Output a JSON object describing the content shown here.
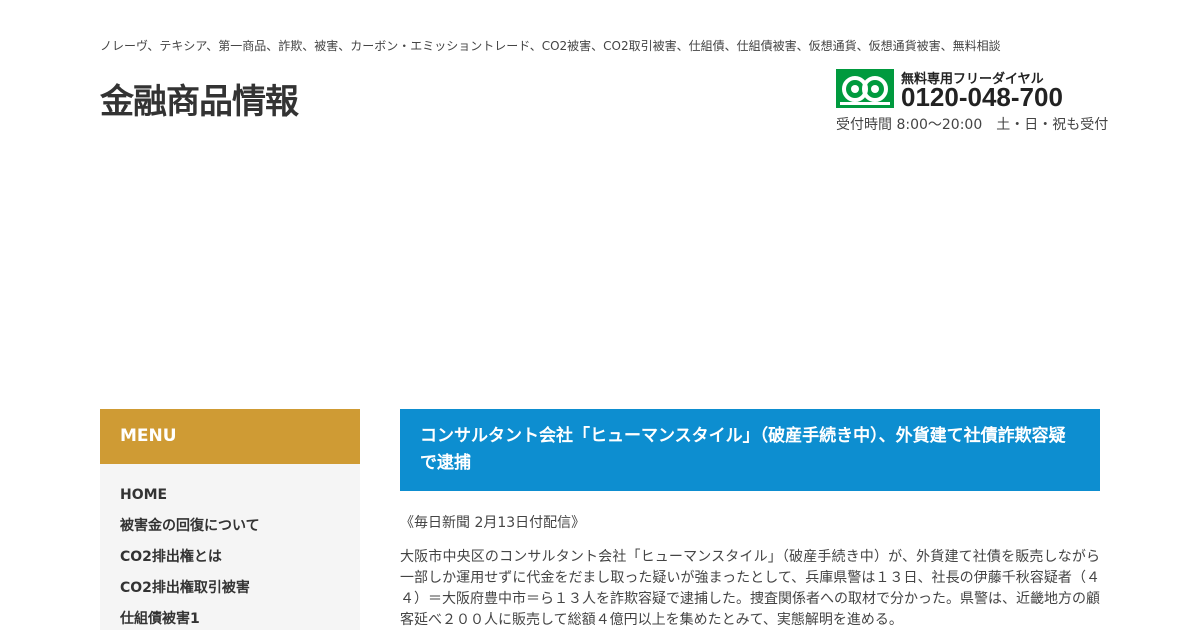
{
  "header": {
    "tagline": "ノレーヴ、テキシア、第一商品、詐欺、被害、カーボン・エミッショントレード、CO2被害、CO2取引被害、仕組債、仕組債被害、仮想通貨、仮想通貨被害、無料相談",
    "site_title": "金融商品情報",
    "contact": {
      "logo_icon": "freedial-icon",
      "logo_color": "#009a3e",
      "label": "無料専用フリーダイヤル",
      "number": "0120-048-700",
      "hours": "受付時間 8:00～20:00　土・日・祝も受付"
    }
  },
  "sidebar": {
    "menu_title": "MENU",
    "menu_title_color": "#cf9b34",
    "items": [
      {
        "label": "HOME"
      },
      {
        "label": "被害金の回復について"
      },
      {
        "label": "CO2排出権とは"
      },
      {
        "label": "CO2排出権取引被害"
      },
      {
        "label": "仕組債被害1"
      }
    ]
  },
  "article": {
    "title": "コンサルタント会社「ヒューマンスタイル」（破産手続き中）、外貨建て社債詐欺容疑で逮捕",
    "title_bg_color": "#0d8ed0",
    "source": "《毎日新聞 2月13日付配信》",
    "body": "大阪市中央区のコンサルタント会社「ヒューマンスタイル」（破産手続き中）が、外貨建て社債を販売しながら一部しか運用せずに代金をだまし取った疑いが強まったとして、兵庫県警は１３日、社長の伊藤千秋容疑者（４４）＝大阪府豊中市＝ら１３人を詐欺容疑で逮捕した。捜査関係者への取材で分かった。県警は、近畿地方の顧客延べ２００人に販売して総額４億円以上を集めたとみて、実態解明を進める。"
  }
}
